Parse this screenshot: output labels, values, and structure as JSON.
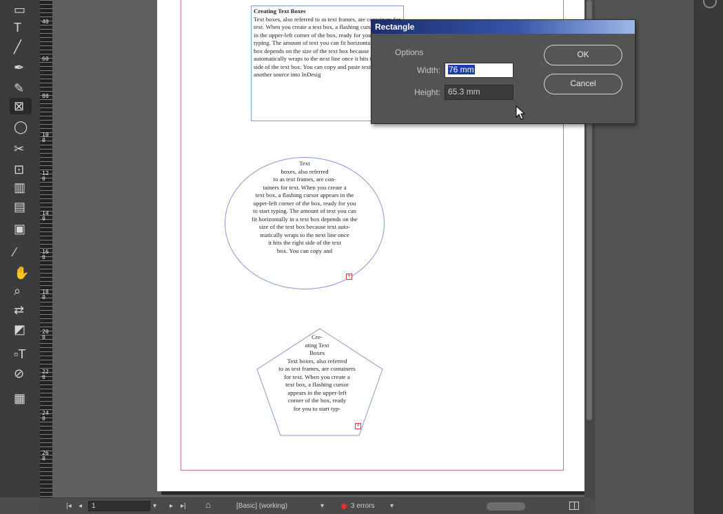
{
  "toolbar": {
    "tools": [
      {
        "name": "frame-icon",
        "glyph": "▭"
      },
      {
        "name": "type-tool-icon",
        "glyph": "T"
      },
      {
        "name": "line-tool-icon",
        "glyph": "╱"
      },
      {
        "name": "pen-tool-icon",
        "glyph": "✒"
      },
      {
        "name": "pencil-tool-icon",
        "glyph": "✎"
      },
      {
        "name": "rectangle-frame-tool-icon",
        "glyph": "⊠"
      },
      {
        "name": "ellipse-tool-icon",
        "glyph": "◯"
      },
      {
        "name": "scissors-tool-icon",
        "glyph": "✂"
      },
      {
        "name": "free-transform-tool-icon",
        "glyph": "⊡"
      },
      {
        "name": "gradient-swatch-tool-icon",
        "glyph": "▥"
      },
      {
        "name": "gradient-feather-tool-icon",
        "glyph": "▤"
      },
      {
        "name": "note-tool-icon",
        "glyph": "▣"
      },
      {
        "name": "eyedropper-tool-icon",
        "glyph": "⁄"
      },
      {
        "name": "hand-tool-icon",
        "glyph": "✋"
      },
      {
        "name": "zoom-tool-icon",
        "glyph": "⌕"
      },
      {
        "name": "swap-colors-icon",
        "glyph": "⇄"
      },
      {
        "name": "fill-stroke-icon",
        "glyph": "◩"
      },
      {
        "name": "formatting-container-icon",
        "glyph": "▫T"
      },
      {
        "name": "apply-none-icon",
        "glyph": "⊘"
      },
      {
        "name": "screen-mode-icon",
        "glyph": "▦"
      }
    ]
  },
  "ruler": {
    "labels": [
      "4 0",
      "6 0",
      "8 0",
      "1 0 0",
      "1 2 0",
      "1 4 0",
      "1 6 0",
      "1 8 0",
      "2 0 0",
      "2 2 0",
      "2 4 0",
      "2 6 0"
    ]
  },
  "document": {
    "rect_frame": {
      "heading": "Creating Text Boxes",
      "body": "Text boxes, also referred to as text frames, are containers for text. When you create a text box, a flashing cursor appears in the upper-left corner of the box, ready for you to start typing. The amount of text you can fit horizontally in a text box depends on the size of the text box because text automatically wraps to the next line once it hits the right side of the text box. You can copy and paste text from another source into InDesig"
    },
    "oval_frame": {
      "lines": [
        "Text",
        "boxes, also referred",
        "to as text frames, are con-",
        "tainers for text. When you create a",
        "text box, a flashing cursor appears in the",
        "upper-left corner of the box, ready for you",
        "to start typing. The amount of text you can",
        "fit horizontally in a text box depends on the",
        "size of the text box because text auto-",
        "matically wraps to the next line once",
        "it hits the right side of the text",
        "box. You can copy and"
      ]
    },
    "pent_frame": {
      "lines": [
        "Cre-",
        "ating Text",
        "Boxes",
        "Text boxes, also referred",
        "to as text frames, are containers",
        "for text. When you create a",
        "text box, a flashing cursor",
        "appears in the upper-left",
        "corner of the box, ready",
        "for you to start typ-"
      ]
    }
  },
  "dialog": {
    "title": "Rectangle",
    "options_label": "Options",
    "width_label": "Width:",
    "width_value": "76 mm",
    "height_label": "Height:",
    "height_value": "65.3 mm",
    "ok_label": "OK",
    "cancel_label": "Cancel"
  },
  "statusbar": {
    "first_page": "|◂",
    "prev_page": "◂",
    "page_number": "1",
    "dropdown": "▾",
    "next_page": "▸",
    "last_page": "▸|",
    "preflight_profile": "[Basic] (working)",
    "profile_dropdown": "▾",
    "errors": "3 errors",
    "errors_dropdown": "▾"
  },
  "colors": {
    "frame_border": "#7f9bd6",
    "margin_guide": "#d06a9c",
    "overset": "#e03030",
    "dialog_title_start": "#1b2d6e",
    "selection": "#1e3da8"
  }
}
